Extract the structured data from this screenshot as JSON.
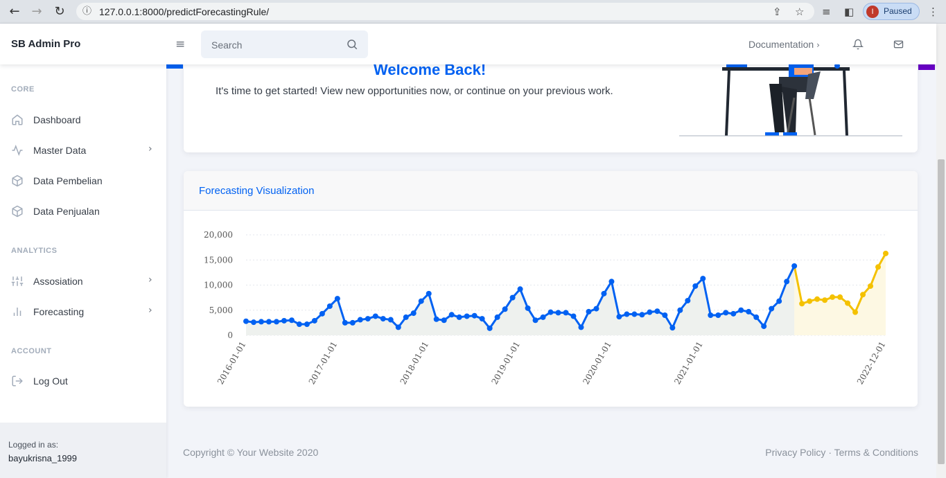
{
  "browser": {
    "url": "127.0.0.1:8000/predictForecastingRule/",
    "profile_initial": "I",
    "profile_status": "Paused"
  },
  "topnav": {
    "brand": "SB Admin Pro",
    "search_placeholder": "Search",
    "documentation": "Documentation"
  },
  "sidebar": {
    "sections": {
      "core": "CORE",
      "analytics": "ANALYTICS",
      "account": "ACCOUNT"
    },
    "items": [
      {
        "label": "Dashboard",
        "icon": "home-icon"
      },
      {
        "label": "Master Data",
        "icon": "activity-icon"
      },
      {
        "label": "Data Pembelian",
        "icon": "package-icon"
      },
      {
        "label": "Data Penjualan",
        "icon": "package-icon"
      },
      {
        "label": "Assosiation",
        "icon": "sliders-icon"
      },
      {
        "label": "Forecasting",
        "icon": "bar-chart-icon"
      },
      {
        "label": "Log Out",
        "icon": "log-out-icon"
      }
    ],
    "logged_in_label": "Logged in as:",
    "username": "bayukrisna_1999"
  },
  "welcome": {
    "title": "Welcome Back!",
    "subtitle": "It's time to get started! View new opportunities now, or continue on your previous work."
  },
  "card": {
    "title": "Forecasting Visualization"
  },
  "footer": {
    "copyright": "Copyright © Your Website 2020",
    "links": "Privacy Policy · Terms & Conditions"
  },
  "chart_data": {
    "type": "line",
    "x_tick_labels": [
      "2016-01-01",
      "2017-01-01",
      "2018-01-01",
      "2019-01-01",
      "2020-01-01",
      "2021-01-01",
      "2022-12-01"
    ],
    "y_tick_labels": [
      "0",
      "5,000",
      "10,000",
      "15,000",
      "20,000"
    ],
    "ylim": [
      0,
      20000
    ],
    "grid": true,
    "colors": {
      "actual": "#0061f2",
      "forecast": "#f4c100"
    },
    "series": [
      {
        "values": [
          2800,
          2600,
          2700,
          2700,
          2700,
          2900,
          3000,
          2200,
          2200,
          2900,
          4300,
          5800,
          7300,
          2500,
          2500,
          3100,
          3300,
          3800,
          3300,
          3100,
          1600,
          3600,
          4400,
          6800,
          8300,
          3200,
          3000,
          4100,
          3600,
          3800,
          3900,
          3300,
          1400,
          3600,
          5200,
          7500,
          9200,
          5400,
          3000,
          3600,
          4600,
          4500,
          4500,
          3800,
          1600,
          4700,
          5300,
          8300,
          10700,
          3700,
          4200,
          4200,
          4100,
          4600,
          4800,
          4000,
          1500,
          5000,
          6900,
          9800,
          11300,
          4000,
          4000,
          4500,
          4300,
          5000,
          4700,
          3600,
          1800,
          5300,
          6800,
          10700,
          13800
        ]
      },
      {
        "values": [
          13800,
          6300,
          6800,
          7200,
          7000,
          7600,
          7600,
          6400,
          4600,
          8100,
          9800,
          13600,
          16300
        ]
      }
    ]
  }
}
